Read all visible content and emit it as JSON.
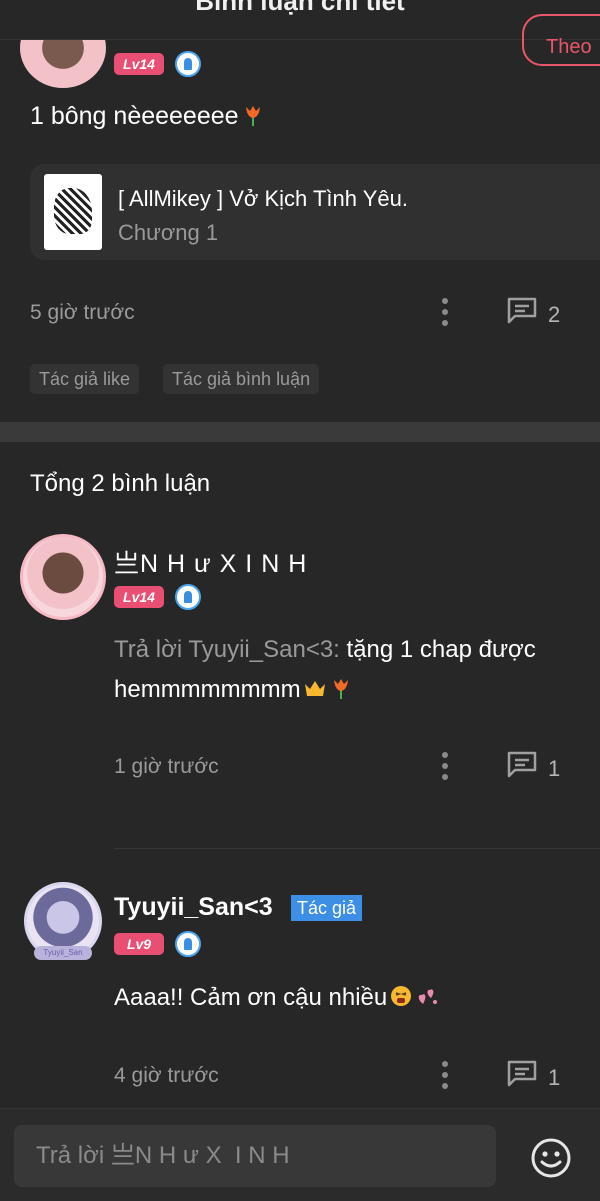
{
  "header": {
    "title": "Bình luận chi tiết"
  },
  "top_comment": {
    "level": "Lv14",
    "follow_label": "Theo",
    "text": "1 bông nèeeeeeee",
    "story": {
      "title": "[ AllMikey ] Vở Kịch Tình Yêu.",
      "chapter": "Chương 1"
    },
    "time": "5 giờ trước",
    "reply_count": "2",
    "tags": [
      "Tác giả like",
      "Tác giả bình luận"
    ]
  },
  "replies": {
    "total_label": "Tổng 2 bình luận",
    "items": [
      {
        "username": "亗N H ư X  I N H",
        "level": "Lv14",
        "reply_prefix": "Trả lời Tyuyii_San<3:",
        "text_line1": " tặng 1 chap được",
        "text_line2": "hemmmmmmmm",
        "time": "1 giờ trước",
        "reply_count": "1"
      },
      {
        "username": "Tyuyii_San<3",
        "author_badge": "Tác giả",
        "level": "Lv9",
        "avatar_tag": "Tyuyii_San",
        "text": "Aaaa!! Cảm ơn cậu nhiều",
        "time": "4 giờ trước",
        "reply_count": "1"
      }
    ]
  },
  "footer": {
    "reply_placeholder": "Trả lời 亗N H ư X  I N H"
  },
  "colors": {
    "accent_pink": "#e94f73",
    "author_blue": "#3d8fe6",
    "background": "#272727"
  }
}
